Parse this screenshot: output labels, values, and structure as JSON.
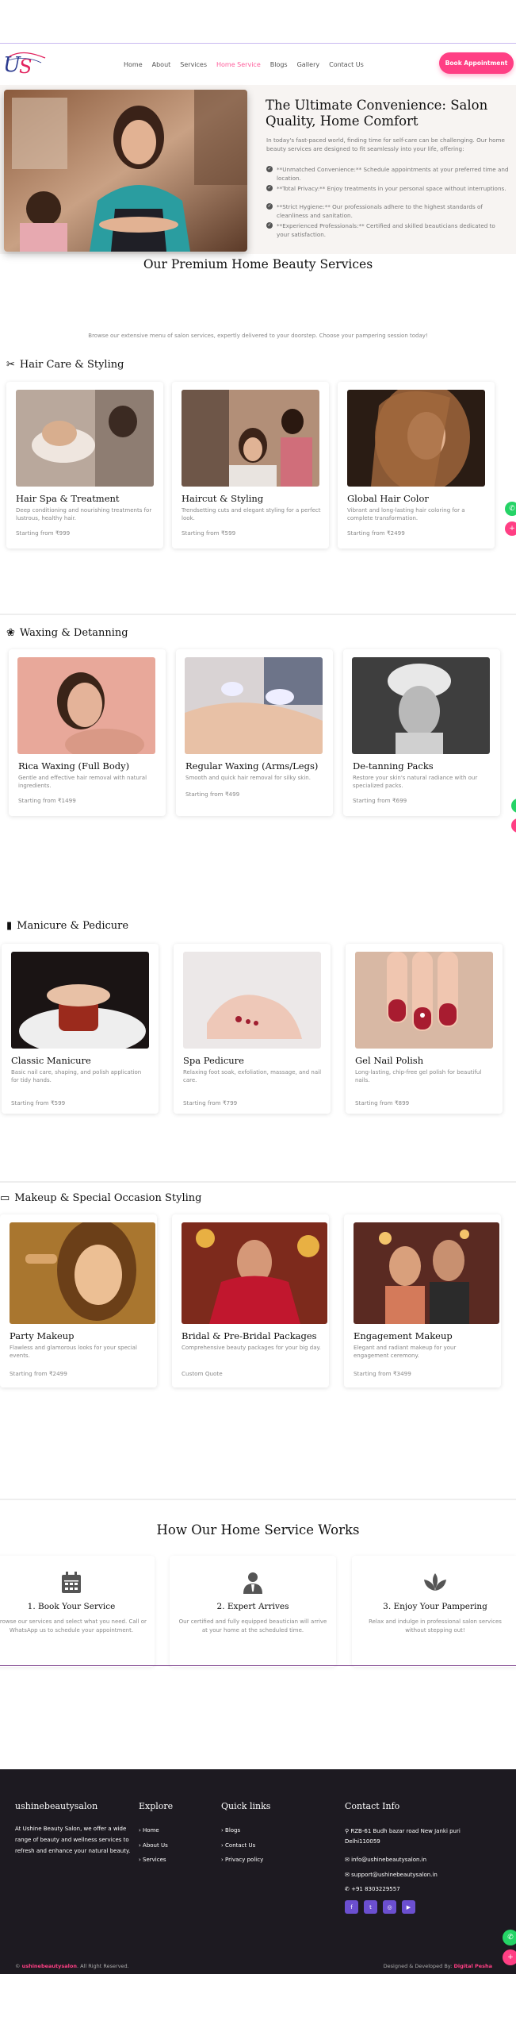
{
  "nav": {
    "logo": "US",
    "items": [
      "Home",
      "About",
      "Services",
      "Home Service",
      "Blogs",
      "Gallery",
      "Contact Us"
    ],
    "active": "Home Service",
    "book_label": "Book Appointment"
  },
  "hero": {
    "title": "The Ultimate Convenience: Salon Quality, Home Comfort",
    "desc": "In today's fast-paced world, finding time for self-care can be challenging. Our home beauty services are designed to fit seamlessly into your life, offering:",
    "points": [
      "**Unmatched Convenience:** Schedule appointments at your preferred time and location.",
      "**Total Privacy:** Enjoy treatments in your personal space without interruptions.",
      "**Strict Hygiene:** Our professionals adhere to the highest standards of cleanliness and sanitation.",
      "**Experienced Professionals:** Certified and skilled beauticians dedicated to your satisfaction."
    ]
  },
  "premium": {
    "title": "Our Premium Home Beauty Services",
    "subtitle": "Browse our extensive menu of salon services, expertly delivered to your doorstep. Choose your pampering session today!"
  },
  "categories": [
    {
      "title": "Hair Care & Styling",
      "icon": "scissors-icon",
      "cards": [
        {
          "title": "Hair Spa & Treatment",
          "desc": "Deep conditioning and nourishing treatments for lustrous, healthy hair.",
          "price": "Starting from ₹999"
        },
        {
          "title": "Haircut & Styling",
          "desc": "Trendsetting cuts and elegant styling for a perfect look.",
          "price": "Starting from ₹599"
        },
        {
          "title": "Global Hair Color",
          "desc": "Vibrant and long-lasting hair coloring for a complete transformation.",
          "price": "Starting from ₹2499"
        }
      ]
    },
    {
      "title": "Waxing & Detanning",
      "icon": "lotus-icon",
      "cards": [
        {
          "title": "Rica Waxing (Full Body)",
          "desc": "Gentle and effective hair removal with natural ingredients.",
          "price": "Starting from ₹1499"
        },
        {
          "title": "Regular Waxing (Arms/Legs)",
          "desc": "Smooth and quick hair removal for silky skin.",
          "price": "Starting from ₹499"
        },
        {
          "title": "De-tanning Packs",
          "desc": "Restore your skin's natural radiance with our specialized packs.",
          "price": "Starting from ₹699"
        }
      ]
    },
    {
      "title": "Manicure & Pedicure",
      "icon": "nail-polish-icon",
      "cards": [
        {
          "title": "Classic Manicure",
          "desc": "Basic nail care, shaping, and polish application for tidy hands.",
          "price": "Starting from ₹599"
        },
        {
          "title": "Spa Pedicure",
          "desc": "Relaxing foot soak, exfoliation, massage, and nail care.",
          "price": "Starting from ₹799"
        },
        {
          "title": "Gel Nail Polish",
          "desc": "Long-lasting, chip-free gel polish for beautiful nails.",
          "price": "Starting from ₹899"
        }
      ]
    },
    {
      "title": "Makeup & Special Occasion Styling",
      "icon": "makeup-icon",
      "cards": [
        {
          "title": "Party Makeup",
          "desc": "Flawless and glamorous looks for your special events.",
          "price": "Starting from ₹2499"
        },
        {
          "title": "Bridal & Pre-Bridal Packages",
          "desc": "Comprehensive beauty packages for your big day.",
          "price": "Custom Quote"
        },
        {
          "title": "Engagement Makeup",
          "desc": "Elegant and radiant makeup for your engagement ceremony.",
          "price": "Starting from ₹3499"
        }
      ]
    }
  ],
  "how": {
    "title": "How Our Home Service Works",
    "steps": [
      {
        "title": "1. Book Your Service",
        "desc": "Browse our services and select what you need. Call or WhatsApp us to schedule your appointment.",
        "icon": "calendar-icon"
      },
      {
        "title": "2. Expert Arrives",
        "desc": "Our certified and fully equipped beautician will arrive at your home at the scheduled time.",
        "icon": "user-tie-icon"
      },
      {
        "title": "3. Enjoy Your Pampering",
        "desc": "Relax and indulge in professional salon services without stepping out!",
        "icon": "spa-icon"
      }
    ]
  },
  "footer": {
    "brand": "ushinebeautysalon",
    "about": "At Ushine Beauty Salon, we offer a wide range of beauty and wellness services to refresh and enhance your natural beauty.",
    "explore_title": "Explore",
    "explore": [
      "Home",
      "About Us",
      "Services"
    ],
    "quick_title": "Quick links",
    "quick": [
      "Blogs",
      "Contact Us",
      "Privacy policy"
    ],
    "contact_title": "Contact Info",
    "address": "RZB-61 Budh bazar road New Janki puri Delhi110059",
    "email1": "info@ushinebeautysalon.in",
    "email2": "support@ushinebeautysalon.in",
    "phone": "+91 8303229557",
    "copyright_prefix": "©",
    "copyright_brand": "ushinebeautysalon",
    "copyright_suffix": ". All Right Reserved.",
    "credit_prefix": "Designed & Developed By:",
    "credit_brand": "Digital Pesha"
  },
  "colors": {
    "accent": "#ff3f84",
    "footer_bg": "#1d1a21",
    "social": "#6b4fd0",
    "whatsapp": "#25d366"
  }
}
